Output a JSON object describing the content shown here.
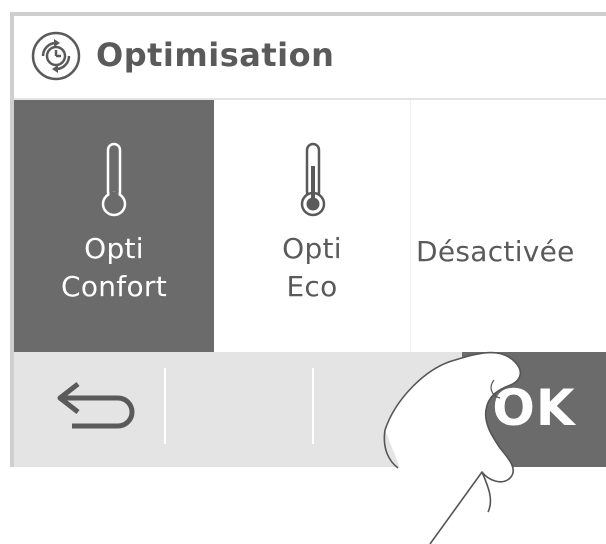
{
  "header": {
    "title": "Optimisation",
    "icon": "clock-cycle-icon"
  },
  "options": [
    {
      "line1": "Opti",
      "line2": "Confort",
      "icon": "thermometer-low-icon",
      "selected": true
    },
    {
      "line1": "Opti",
      "line2": "Eco",
      "icon": "thermometer-high-icon",
      "selected": false
    },
    {
      "line1": "Désactivée",
      "line2": "",
      "icon": "",
      "selected": false
    }
  ],
  "bottom_bar": {
    "back_icon": "back-arrow-icon",
    "ok_label": "OK"
  },
  "colors": {
    "selected_bg": "#6b6b6b",
    "bar_bg": "#e4e4e4",
    "text": "#5a5a5a"
  }
}
